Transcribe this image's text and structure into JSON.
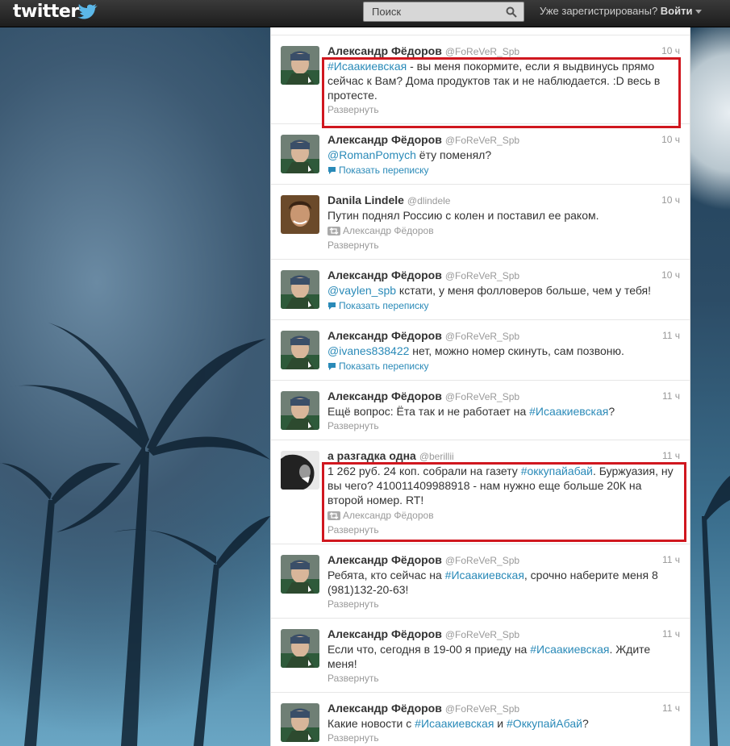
{
  "header": {
    "logo": "twitter",
    "search_placeholder": "Поиск",
    "login_prompt": "Уже зарегистрированы?",
    "login_link": "Войти"
  },
  "tweets": [
    {
      "avatar": "avatar-fedorov",
      "name": "Александр Фёдоров",
      "handle": "@FoReVeR_Spb",
      "time": "10 ч",
      "parts": [
        {
          "t": "#Исаакиевская",
          "k": "tag"
        },
        {
          "t": " - вы меня покормите, если я выдвинусь прямо сейчас к Вам? Дома продуктов так и не наблюдается. :D весь в протесте.",
          "k": ""
        }
      ],
      "meta": null,
      "meta_type": null,
      "expand": "Развернуть"
    },
    {
      "avatar": "avatar-fedorov",
      "name": "Александр Фёдоров",
      "handle": "@FoReVeR_Spb",
      "time": "10 ч",
      "parts": [
        {
          "t": "@RomanPomych",
          "k": "mention"
        },
        {
          "t": " ёту поменял?",
          "k": ""
        }
      ],
      "meta": "Показать переписку",
      "meta_type": "conversation",
      "expand": null
    },
    {
      "avatar": "avatar-danila",
      "name": "Danila Lindele",
      "handle": "@dlindele",
      "time": "10 ч",
      "parts": [
        {
          "t": "Путин поднял Россию с колен и поставил ее раком.",
          "k": ""
        }
      ],
      "meta": "Александр Фёдоров",
      "meta_type": "retweet",
      "expand": "Развернуть"
    },
    {
      "avatar": "avatar-fedorov",
      "name": "Александр Фёдоров",
      "handle": "@FoReVeR_Spb",
      "time": "10 ч",
      "parts": [
        {
          "t": "@vaylen_spb",
          "k": "mention"
        },
        {
          "t": " кстати, у меня фолловеров больше, чем у тебя!",
          "k": ""
        }
      ],
      "meta": "Показать переписку",
      "meta_type": "conversation",
      "expand": null
    },
    {
      "avatar": "avatar-fedorov",
      "name": "Александр Фёдоров",
      "handle": "@FoReVeR_Spb",
      "time": "11 ч",
      "parts": [
        {
          "t": "@ivanes838422",
          "k": "mention"
        },
        {
          "t": " нет, можно номер скинуть, сам позвоню.",
          "k": ""
        }
      ],
      "meta": "Показать переписку",
      "meta_type": "conversation",
      "expand": null
    },
    {
      "avatar": "avatar-fedorov",
      "name": "Александр Фёдоров",
      "handle": "@FoReVeR_Spb",
      "time": "11 ч",
      "parts": [
        {
          "t": "Ещё вопрос: Ёта так и не работает на ",
          "k": ""
        },
        {
          "t": "#Исаакиевская",
          "k": "tag"
        },
        {
          "t": "?",
          "k": ""
        }
      ],
      "meta": null,
      "meta_type": null,
      "expand": "Развернуть"
    },
    {
      "avatar": "avatar-berilliii",
      "name": "а разгадка одна",
      "handle": "@berillii",
      "time": "11 ч",
      "parts": [
        {
          "t": "1 262 руб. 24 коп. собрали на газету ",
          "k": ""
        },
        {
          "t": "#оккупайабай",
          "k": "tag"
        },
        {
          "t": ". Буржуазия, ну вы чего? 410011409988918 - нам нужно еще больше 20К на второй номер. RT!",
          "k": ""
        }
      ],
      "meta": "Александр Фёдоров",
      "meta_type": "retweet",
      "expand": "Развернуть"
    },
    {
      "avatar": "avatar-fedorov",
      "name": "Александр Фёдоров",
      "handle": "@FoReVeR_Spb",
      "time": "11 ч",
      "parts": [
        {
          "t": "Ребята, кто сейчас на ",
          "k": ""
        },
        {
          "t": "#Исаакиевская",
          "k": "tag"
        },
        {
          "t": ", срочно наберите меня 8 (981)132-20-63!",
          "k": ""
        }
      ],
      "meta": null,
      "meta_type": null,
      "expand": "Развернуть"
    },
    {
      "avatar": "avatar-fedorov",
      "name": "Александр Фёдоров",
      "handle": "@FoReVeR_Spb",
      "time": "11 ч",
      "parts": [
        {
          "t": "Если что, сегодня в 19-00 я приеду на ",
          "k": ""
        },
        {
          "t": "#Исаакиевская",
          "k": "tag"
        },
        {
          "t": ". Ждите меня!",
          "k": ""
        }
      ],
      "meta": null,
      "meta_type": null,
      "expand": "Развернуть"
    },
    {
      "avatar": "avatar-fedorov",
      "name": "Александр Фёдоров",
      "handle": "@FoReVeR_Spb",
      "time": "11 ч",
      "parts": [
        {
          "t": "Какие новости с ",
          "k": ""
        },
        {
          "t": "#Исаакиевская",
          "k": "tag"
        },
        {
          "t": " и ",
          "k": ""
        },
        {
          "t": "#ОккупайАбай",
          "k": "tag"
        },
        {
          "t": "?",
          "k": ""
        }
      ],
      "meta": null,
      "meta_type": null,
      "expand": "Развернуть"
    }
  ],
  "colors": {
    "link": "#2a8ab8",
    "highlight": "#d0171f",
    "topbar": "#222222"
  }
}
